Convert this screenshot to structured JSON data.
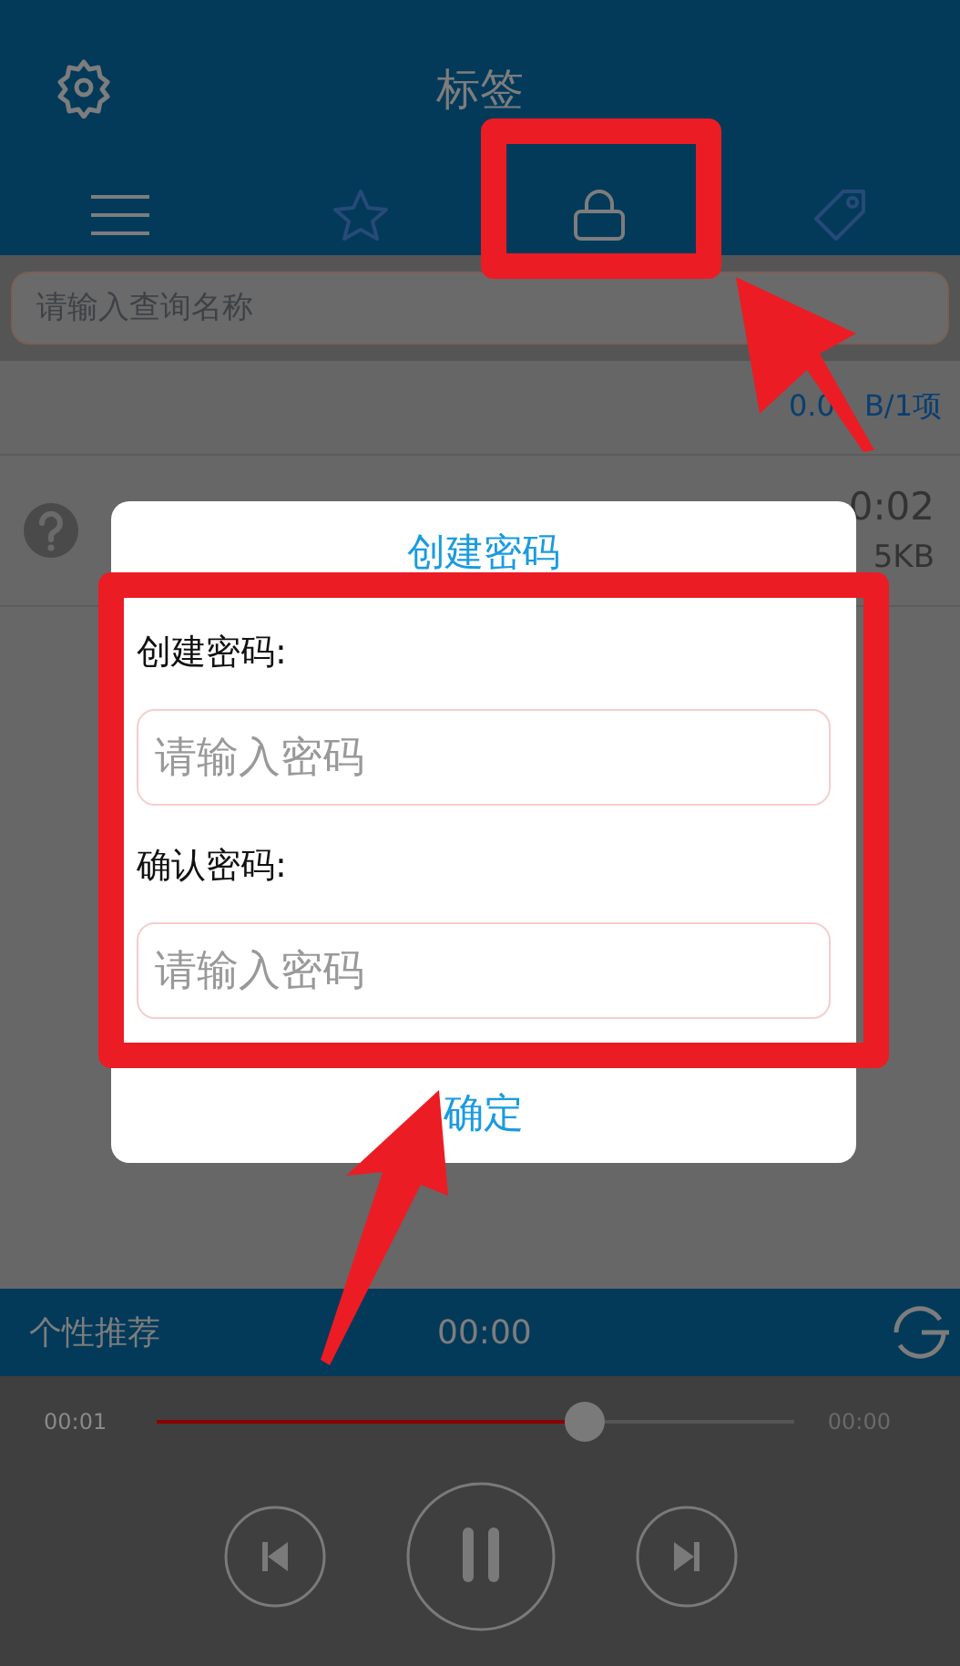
{
  "header": {
    "title": "标签"
  },
  "search": {
    "placeholder": "请输入查询名称"
  },
  "summary": [
    "0.0",
    "B/1项"
  ],
  "list_row": {
    "time": "0:02",
    "size": "5KB"
  },
  "dialog": {
    "title": "创建密码",
    "fields": [
      {
        "label": "创建密码:",
        "placeholder": "请输入密码"
      },
      {
        "label": "确认密码:",
        "placeholder": "请输入密码"
      }
    ],
    "confirm": "确定"
  },
  "bottom_bar": {
    "label": "个性推荐",
    "time": "00:00"
  },
  "player": {
    "elapsed": "00:01",
    "total": "00:00",
    "level": 0.66,
    "playing": true
  }
}
